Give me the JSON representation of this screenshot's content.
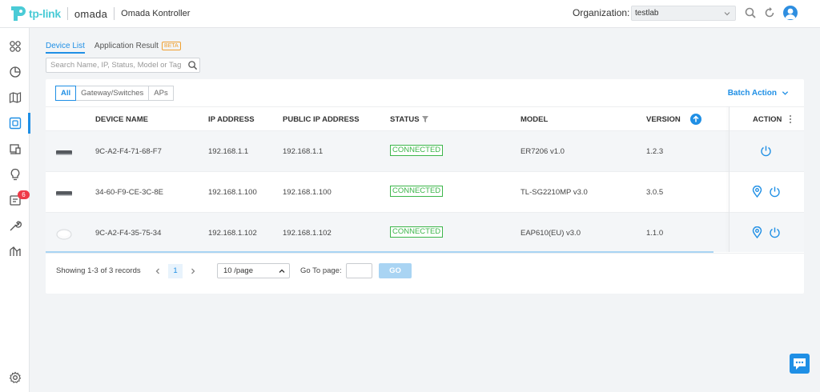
{
  "header": {
    "brand_tplink": "tp-link",
    "brand_omada": "omada",
    "app_name": "Omada Kontroller",
    "org_label": "Organization:",
    "org_value": "testlab"
  },
  "sidebar": {
    "items": [
      {
        "icon": "dashboard-icon"
      },
      {
        "icon": "statistics-icon"
      },
      {
        "icon": "map-icon"
      },
      {
        "icon": "devices-icon",
        "active": true
      },
      {
        "icon": "clients-icon"
      },
      {
        "icon": "insight-icon"
      },
      {
        "icon": "logs-icon",
        "badge": "6"
      },
      {
        "icon": "tools-icon"
      },
      {
        "icon": "reports-icon"
      },
      {
        "icon": "settings-icon"
      }
    ]
  },
  "tabs": {
    "device_list": "Device List",
    "application_result": "Application Result",
    "beta": "BETA"
  },
  "search": {
    "placeholder": "Search Name, IP, Status, Model or Tag"
  },
  "filters": {
    "all": "All",
    "gateway_switches": "Gateway/Switches",
    "aps": "APs"
  },
  "batch_action": "Batch Action",
  "table": {
    "columns": {
      "device_name": "DEVICE NAME",
      "ip_address": "IP ADDRESS",
      "public_ip": "PUBLIC IP ADDRESS",
      "status": "STATUS",
      "model": "MODEL",
      "version": "VERSION",
      "action": "ACTION"
    },
    "rows": [
      {
        "type": "gateway",
        "name": "9C-A2-F4-71-68-F7",
        "ip": "192.168.1.1",
        "public_ip": "192.168.1.1",
        "status": "CONNECTED",
        "model": "ER7206 v1.0",
        "version": "1.2.3"
      },
      {
        "type": "switch",
        "name": "34-60-F9-CE-3C-8E",
        "ip": "192.168.1.100",
        "public_ip": "192.168.1.100",
        "status": "CONNECTED",
        "model": "TL-SG2210MP v3.0",
        "version": "3.0.5"
      },
      {
        "type": "ap",
        "name": "9C-A2-F4-35-75-34",
        "ip": "192.168.1.102",
        "public_ip": "192.168.1.102",
        "status": "CONNECTED",
        "model": "EAP610(EU) v3.0",
        "version": "1.1.0"
      }
    ]
  },
  "pagination": {
    "records": "Showing 1-3 of 3 records",
    "current_page": "1",
    "page_size": "10 /page",
    "goto_label": "Go To page:",
    "go": "GO"
  },
  "colors": {
    "accent": "#1f8fe5",
    "connected": "#3cb64a",
    "badge": "#ee3a48"
  }
}
